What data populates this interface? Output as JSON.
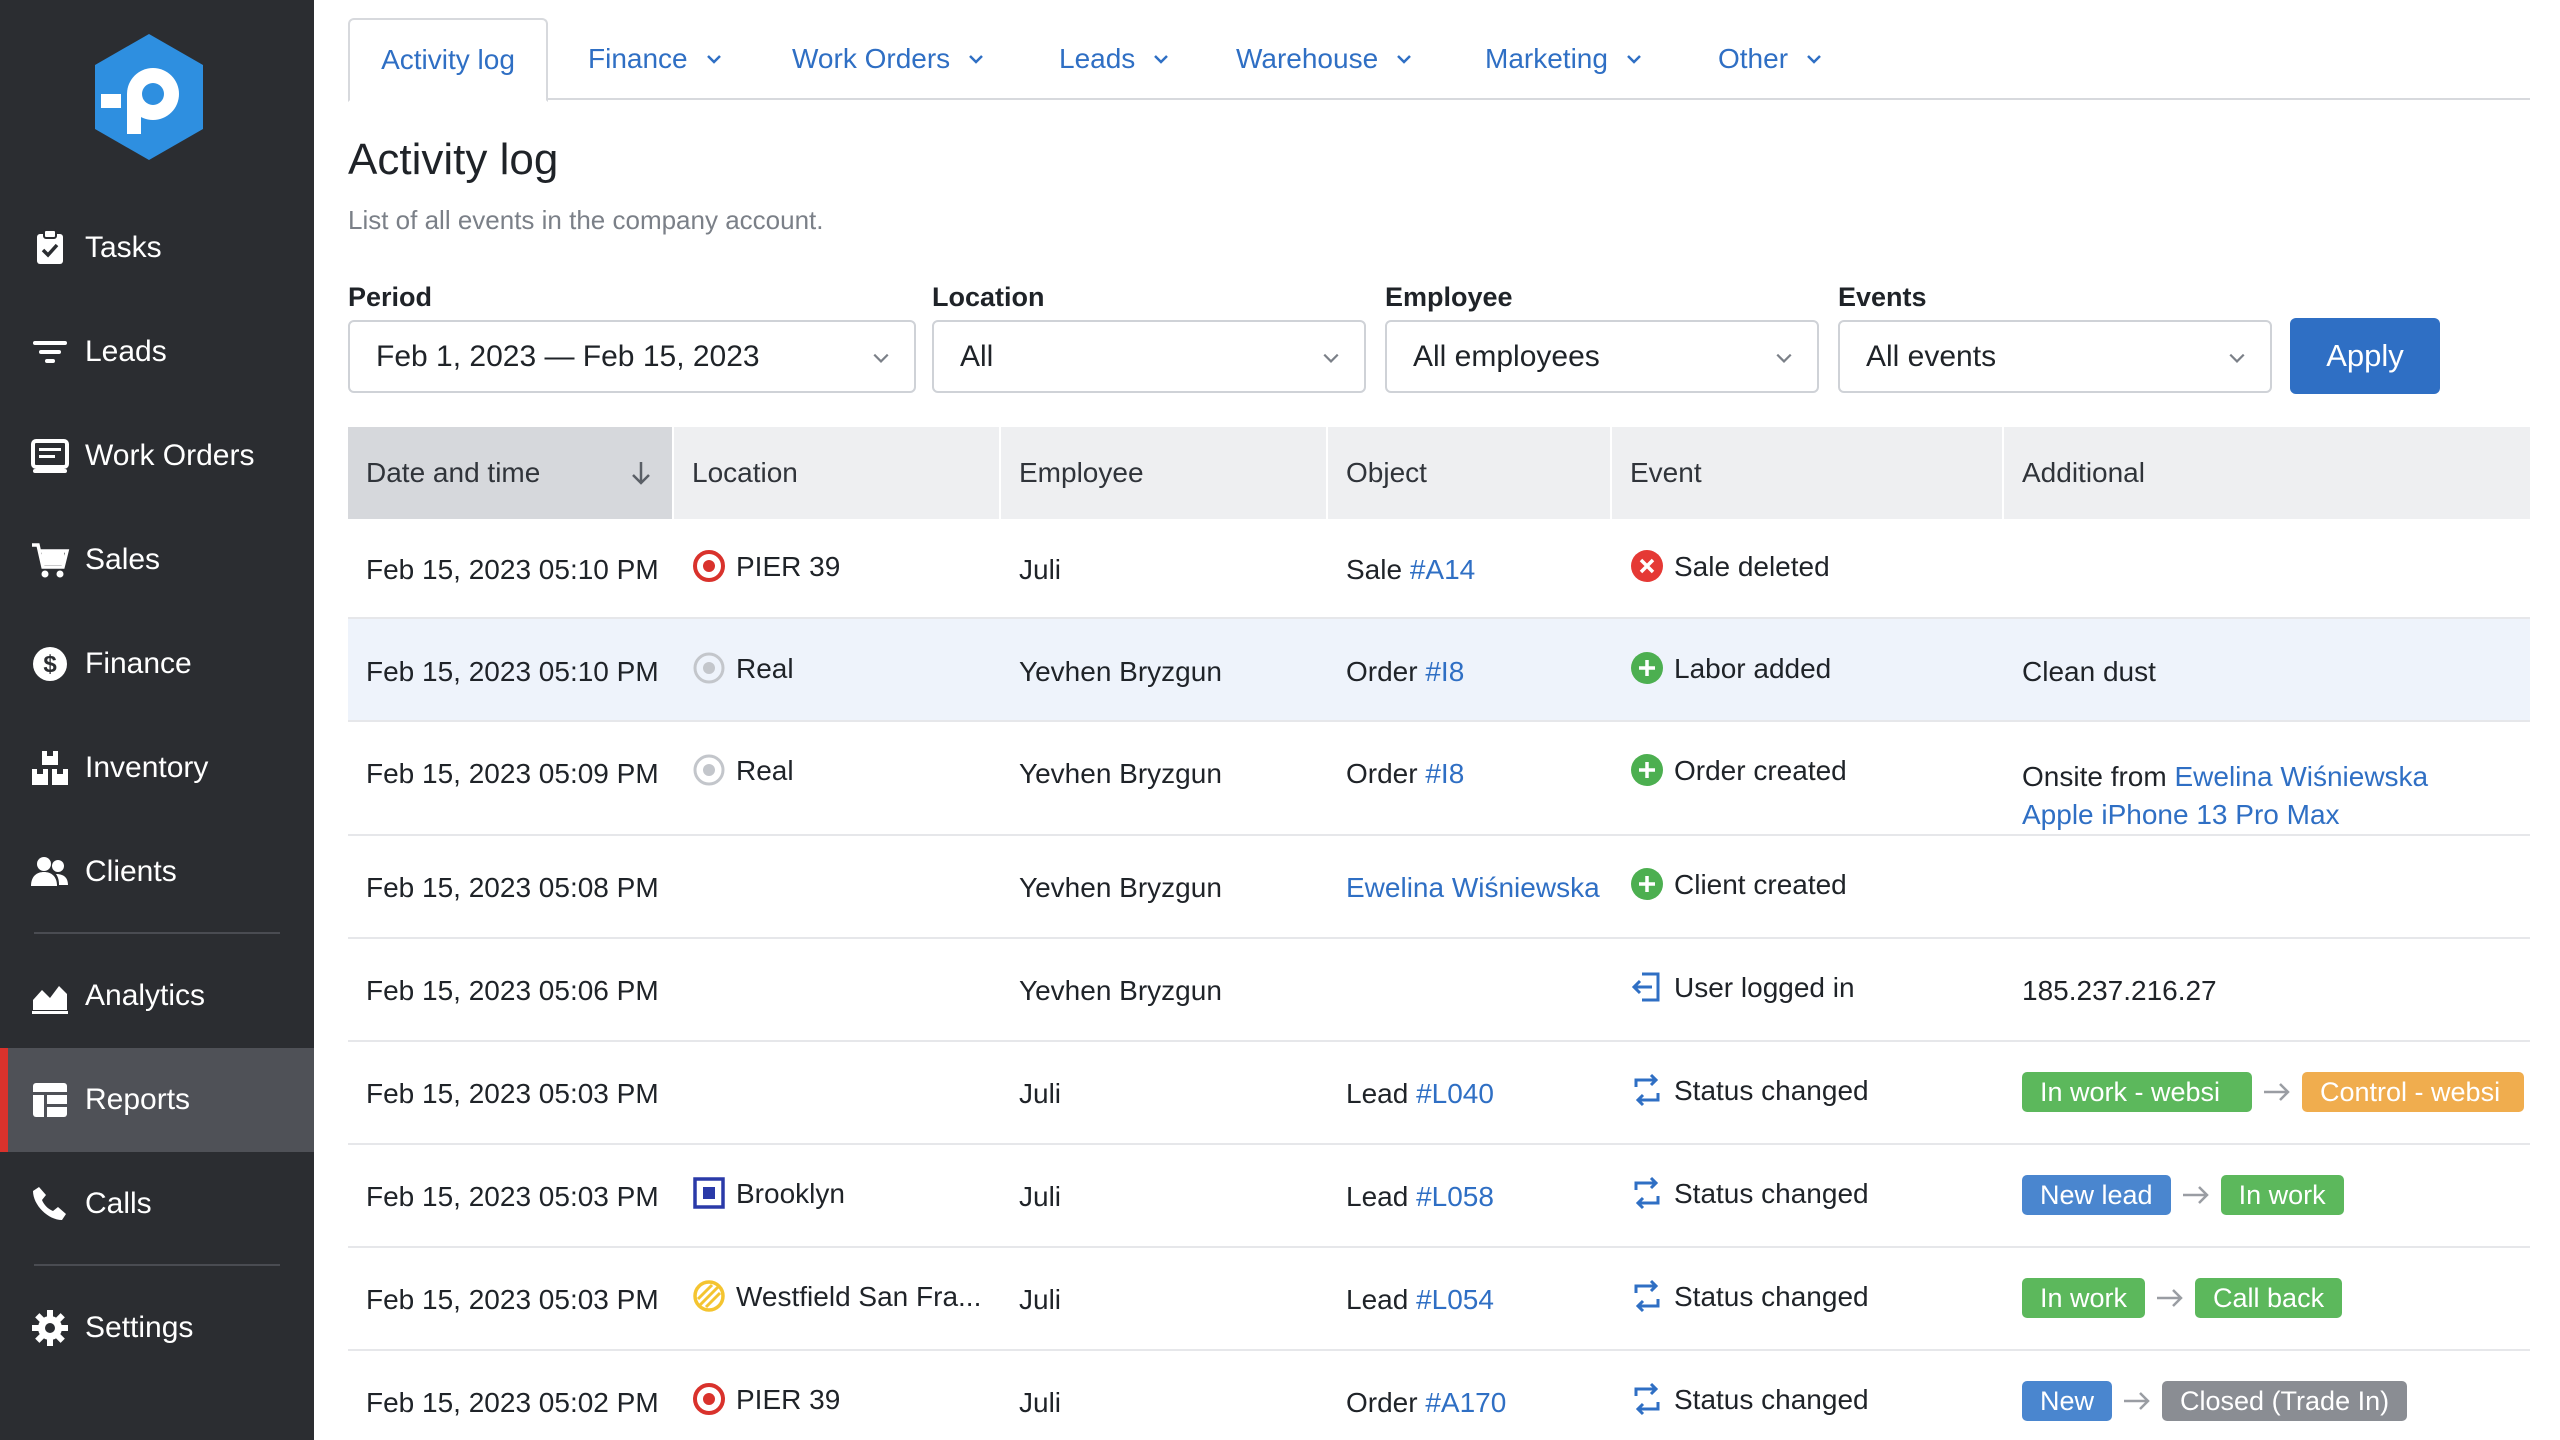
{
  "sidebar": {
    "items": [
      {
        "label": "Tasks",
        "icon": "clipboard-check-icon"
      },
      {
        "label": "Leads",
        "icon": "filter-icon"
      },
      {
        "label": "Work Orders",
        "icon": "work-order-icon"
      },
      {
        "label": "Sales",
        "icon": "cart-icon"
      },
      {
        "label": "Finance",
        "icon": "dollar-icon"
      },
      {
        "label": "Inventory",
        "icon": "boxes-icon"
      },
      {
        "label": "Clients",
        "icon": "users-icon"
      },
      {
        "label": "Analytics",
        "icon": "chart-area-icon"
      },
      {
        "label": "Reports",
        "icon": "table-icon",
        "active": true
      },
      {
        "label": "Calls",
        "icon": "phone-icon"
      },
      {
        "label": "Settings",
        "icon": "gear-icon"
      }
    ]
  },
  "tabs": [
    {
      "label": "Activity log",
      "active": true
    },
    {
      "label": "Finance"
    },
    {
      "label": "Work Orders"
    },
    {
      "label": "Leads"
    },
    {
      "label": "Warehouse"
    },
    {
      "label": "Marketing"
    },
    {
      "label": "Other"
    }
  ],
  "page": {
    "title": "Activity log",
    "subtitle": "List of all events in the company account."
  },
  "filters": {
    "period_label": "Period",
    "period_value": "Feb 1, 2023 — Feb 15, 2023",
    "location_label": "Location",
    "location_value": "All",
    "employee_label": "Employee",
    "employee_value": "All employees",
    "events_label": "Events",
    "events_value": "All events",
    "apply_label": "Apply"
  },
  "table": {
    "headers": [
      "Date and time",
      "Location",
      "Employee",
      "Object",
      "Event",
      "Additional"
    ],
    "rows": [
      {
        "date": "Feb 15, 2023 05:10 PM",
        "location": "PIER 39",
        "loc_icon": "target-red",
        "employee": "Juli",
        "obj_prefix": "Sale ",
        "obj_link": "#A14",
        "event": "Sale deleted",
        "ev_icon": "x-circle",
        "additional": ""
      },
      {
        "date": "Feb 15, 2023 05:10 PM",
        "location": "Real",
        "loc_icon": "target-gray",
        "employee": "Yevhen Bryzgun",
        "obj_prefix": "Order ",
        "obj_link": "#I8",
        "event": "Labor added",
        "ev_icon": "plus-circle",
        "additional": "Clean dust"
      },
      {
        "date": "Feb 15, 2023 05:09 PM",
        "location": "Real",
        "loc_icon": "target-gray",
        "employee": "Yevhen Bryzgun",
        "obj_prefix": "Order ",
        "obj_link": "#I8",
        "event": "Order created",
        "ev_icon": "plus-circle",
        "add_prefix": "Onsite from ",
        "add_link1": "Ewelina Wiśniewska",
        "add_link2": "Apple iPhone 13 Pro Max"
      },
      {
        "date": "Feb 15, 2023 05:08 PM",
        "location": "",
        "employee": "Yevhen Bryzgun",
        "obj_prefix": "",
        "obj_link": "Ewelina Wiśniewska",
        "event": "Client created",
        "ev_icon": "plus-circle",
        "additional": ""
      },
      {
        "date": "Feb 15, 2023 05:06 PM",
        "location": "",
        "employee": "Yevhen Bryzgun",
        "obj_prefix": "",
        "obj_link": "",
        "event": "User logged in",
        "ev_icon": "login",
        "additional": "185.237.216.27"
      },
      {
        "date": "Feb 15, 2023 05:03 PM",
        "location": "",
        "employee": "Juli",
        "obj_prefix": "Lead ",
        "obj_link": "#L040",
        "event": "Status changed",
        "ev_icon": "refresh",
        "from": "In work - websi",
        "from_color": "#5cb85c",
        "to": "Control - websi",
        "to_color": "#f0ad4e"
      },
      {
        "date": "Feb 15, 2023 05:03 PM",
        "location": "Brooklyn",
        "loc_icon": "square-blue",
        "employee": "Juli",
        "obj_prefix": "Lead ",
        "obj_link": "#L058",
        "event": "Status changed",
        "ev_icon": "refresh",
        "from": "New lead",
        "from_color": "#4a86cf",
        "to": "In work",
        "to_color": "#5cb85c"
      },
      {
        "date": "Feb 15, 2023 05:03 PM",
        "location": "Westfield San Fra...",
        "loc_icon": "slash-yellow",
        "employee": "Juli",
        "obj_prefix": "Lead ",
        "obj_link": "#L054",
        "event": "Status changed",
        "ev_icon": "refresh",
        "from": "In work",
        "from_color": "#5cb85c",
        "to": "Call back",
        "to_color": "#5cb85c"
      },
      {
        "date": "Feb 15, 2023 05:02 PM",
        "location": "PIER 39",
        "loc_icon": "target-red",
        "employee": "Juli",
        "obj_prefix": "Order ",
        "obj_link": "#A170",
        "event": "Status changed",
        "ev_icon": "refresh",
        "from": "New",
        "from_color": "#4a86cf",
        "to": "Closed (Trade In)",
        "to_color": "#8a8d93"
      }
    ]
  },
  "colors": {
    "accent": "#2f6fc4",
    "sidebar": "#2b2d31",
    "active_marker": "#d9322c"
  }
}
